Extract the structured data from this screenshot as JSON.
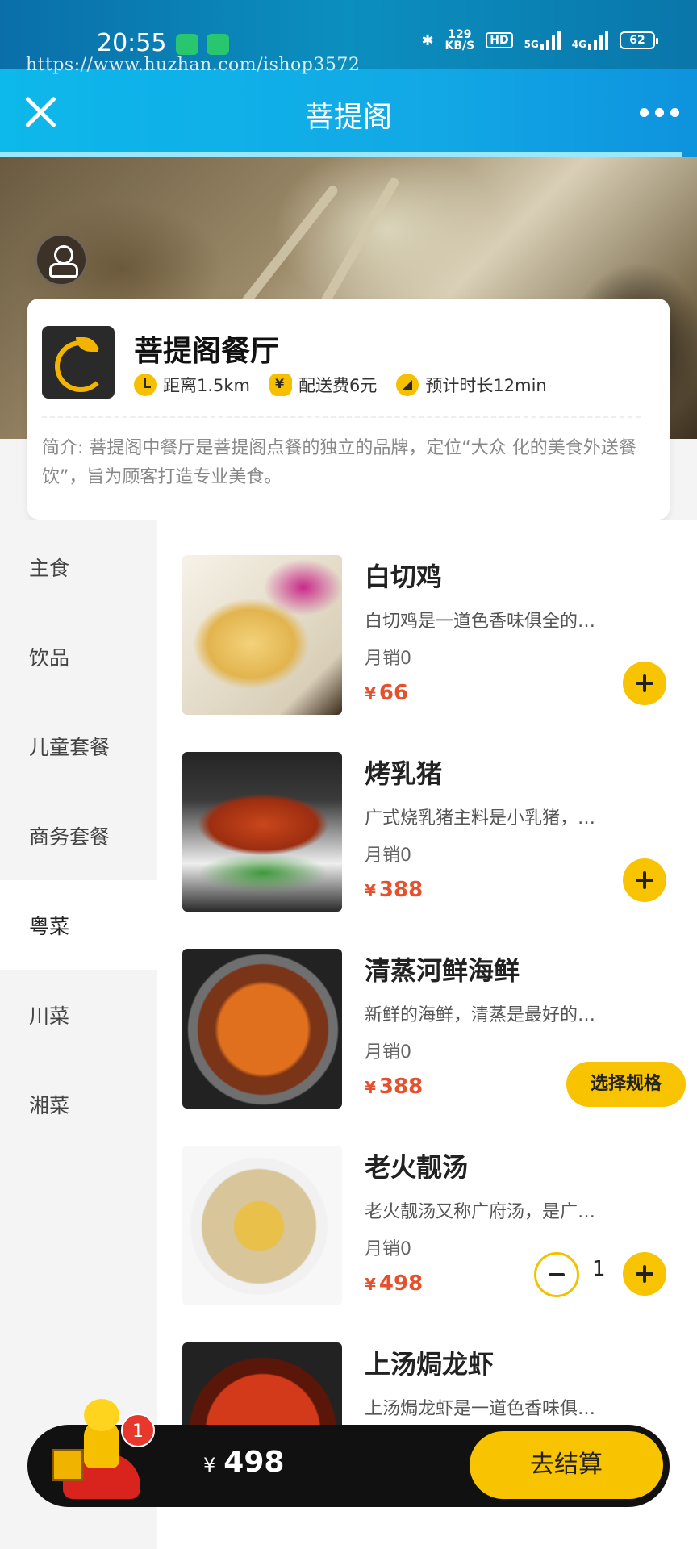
{
  "status_bar": {
    "time": "20:55",
    "network_speed": "129",
    "network_unit": "KB/S",
    "hd_label": "HD",
    "signal_5g": "5G",
    "signal_4g": "4G",
    "battery": "62"
  },
  "watermark": "https://www.huzhan.com/ishop3572",
  "navbar": {
    "title": "菩提阁"
  },
  "shop": {
    "name": "菩提阁餐厅",
    "distance": "距离1.5km",
    "delivery_fee": "配送费6元",
    "eta": "预计时长12min",
    "intro": "简介: 菩提阁中餐厅是菩提阁点餐的独立的品牌，定位“大众 化的美食外送餐饮”，旨为顾客打造专业美食。"
  },
  "categories": [
    {
      "label": "主食"
    },
    {
      "label": "饮品"
    },
    {
      "label": "儿童套餐"
    },
    {
      "label": "商务套餐"
    },
    {
      "label": "粤菜",
      "active": true
    },
    {
      "label": "川菜"
    },
    {
      "label": "湘菜"
    }
  ],
  "items": [
    {
      "name": "白切鸡",
      "desc": "白切鸡是一道色香味俱全的…",
      "sales": "月销0",
      "currency": "¥",
      "price": "66",
      "action": "add"
    },
    {
      "name": "烤乳猪",
      "desc": "广式烧乳猪主料是小乳猪，…",
      "sales": "月销0",
      "currency": "¥",
      "price": "388",
      "action": "add"
    },
    {
      "name": "清蒸河鲜海鲜",
      "desc": "新鲜的海鲜，清蒸是最好的…",
      "sales": "月销0",
      "currency": "¥",
      "price": "388",
      "action": "spec",
      "spec_label": "选择规格"
    },
    {
      "name": "老火靓汤",
      "desc": "老火靓汤又称广府汤，是广…",
      "sales": "月销0",
      "currency": "¥",
      "price": "498",
      "action": "stepper",
      "qty": "1"
    },
    {
      "name": "上汤焗龙虾",
      "desc": "上汤焗龙虾是一道色香味俱…",
      "sales": "",
      "currency": "",
      "price": "",
      "action": "none"
    }
  ],
  "cart": {
    "badge_count": "1",
    "currency": "¥",
    "total": "498",
    "checkout_label": "去结算"
  },
  "colors": {
    "accent": "#f8c300",
    "price": "#e5502d",
    "nav": "#12a9e6"
  }
}
